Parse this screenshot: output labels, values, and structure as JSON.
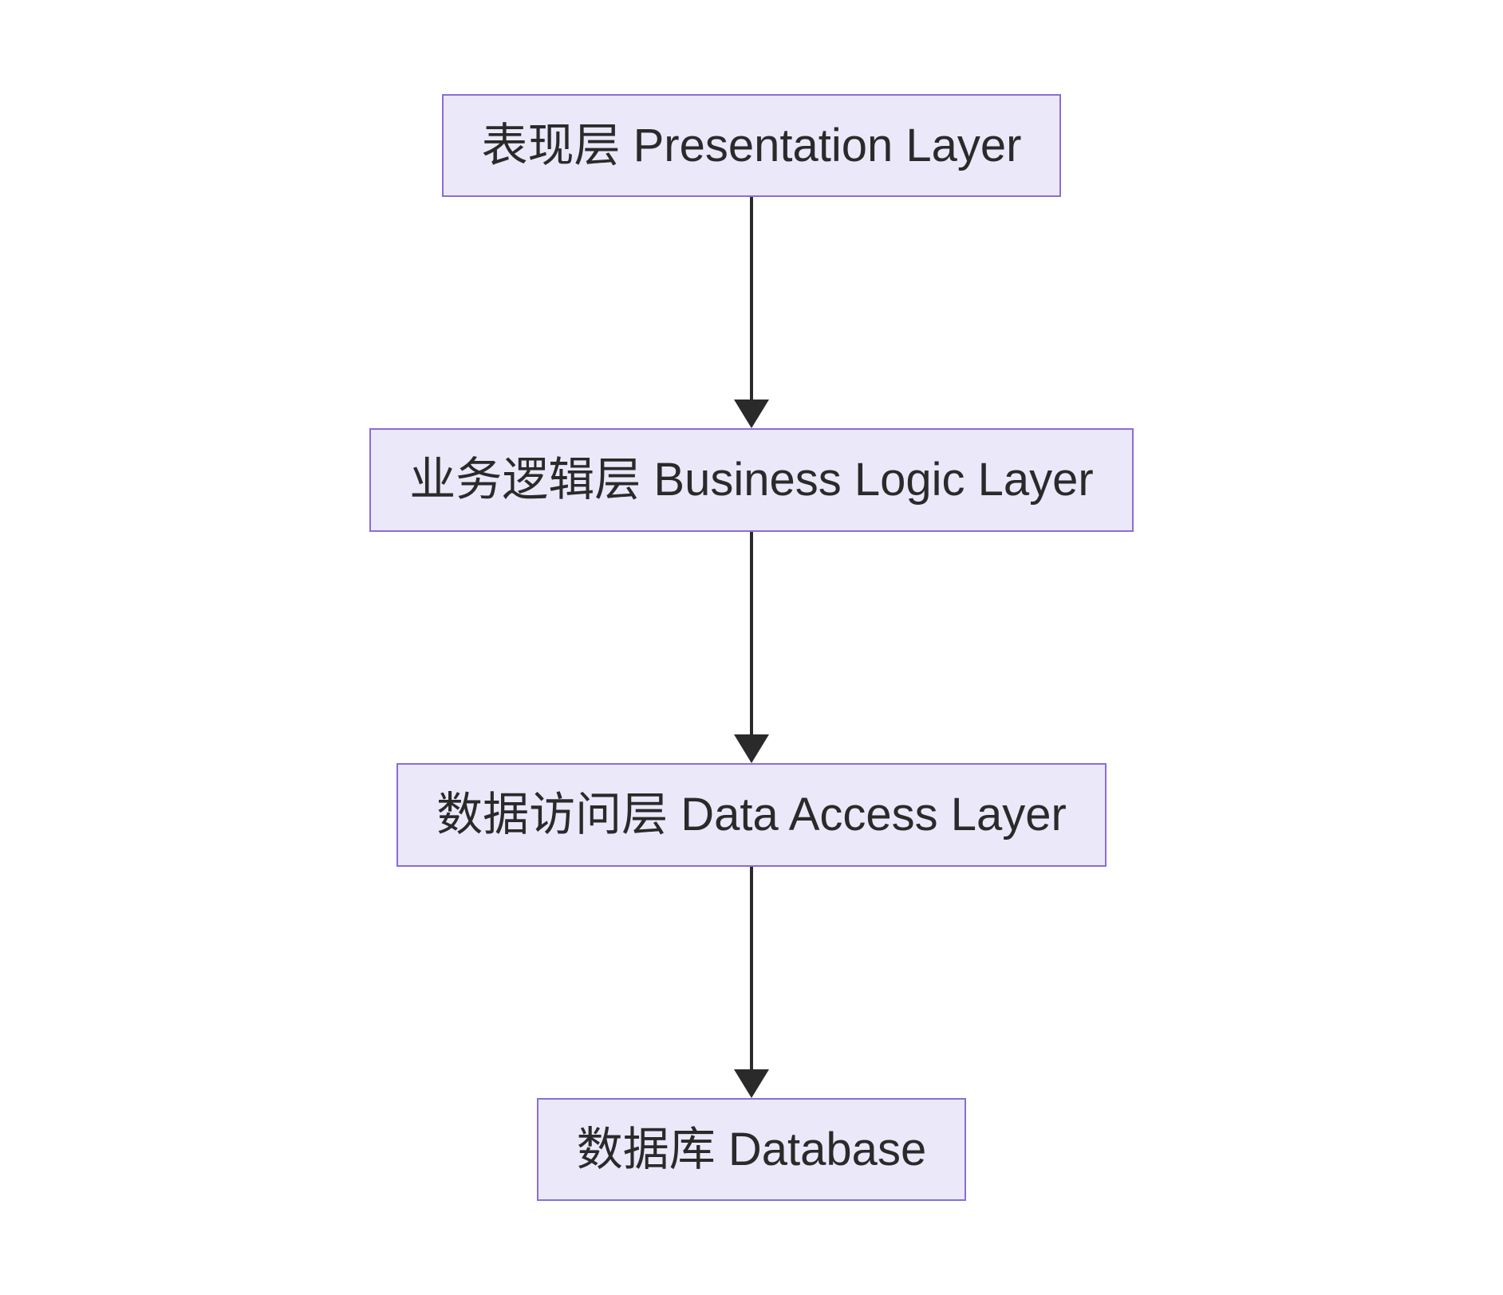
{
  "diagram": {
    "type": "flowchart",
    "direction": "top-down",
    "nodes": [
      {
        "id": "presentation",
        "label": "表现层 Presentation Layer"
      },
      {
        "id": "business",
        "label": "业务逻辑层 Business Logic Layer"
      },
      {
        "id": "dataaccess",
        "label": "数据访问层 Data Access Layer"
      },
      {
        "id": "database",
        "label": "数据库 Database"
      }
    ],
    "edges": [
      {
        "from": "presentation",
        "to": "business"
      },
      {
        "from": "business",
        "to": "dataaccess"
      },
      {
        "from": "dataaccess",
        "to": "database"
      }
    ],
    "style": {
      "node_fill": "#ebe8f9",
      "node_border": "#8a6dd9",
      "arrow_color": "#2a2a2a"
    }
  }
}
